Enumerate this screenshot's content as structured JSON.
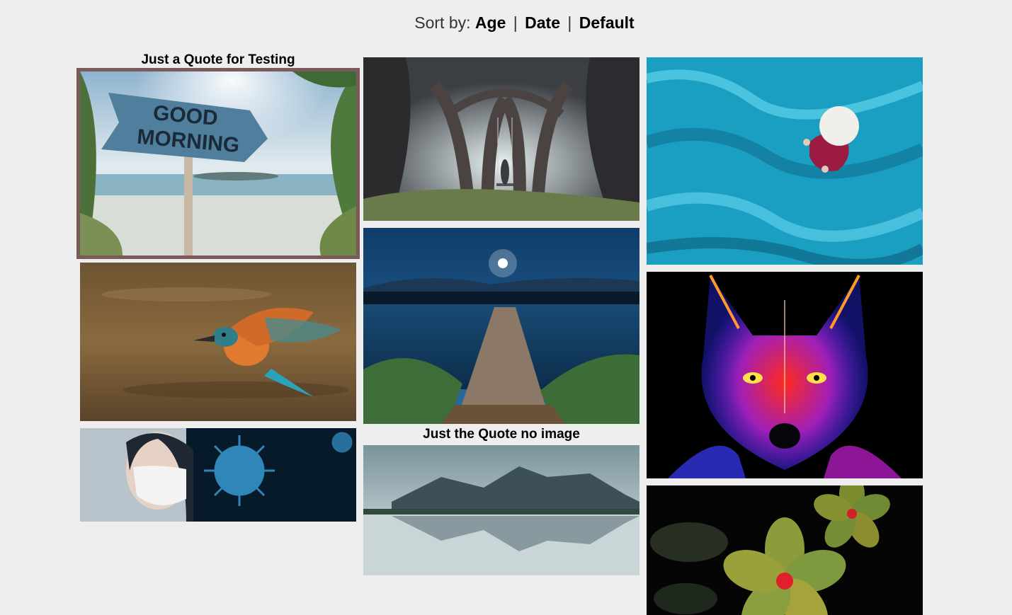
{
  "sort": {
    "prefix": "Sort by:",
    "options": [
      "Age",
      "Date",
      "Default"
    ],
    "separator": "|"
  },
  "cards": [
    {
      "id": "good-morning",
      "caption": "Just a Quote for Testing",
      "sign_line1": "GOOD",
      "sign_line2": "MORNING",
      "selected": true
    },
    {
      "id": "forest-swing"
    },
    {
      "id": "blue-fabric"
    },
    {
      "id": "kingfisher"
    },
    {
      "id": "lake-pier"
    },
    {
      "id": "neon-wolf"
    },
    {
      "id": "virus-mask"
    },
    {
      "id": "mountain-lake",
      "caption": "Just the Quote no image"
    },
    {
      "id": "plumeria"
    }
  ],
  "colors": {
    "background": "#eeeeee",
    "selected_border": "#7a5a5a"
  }
}
